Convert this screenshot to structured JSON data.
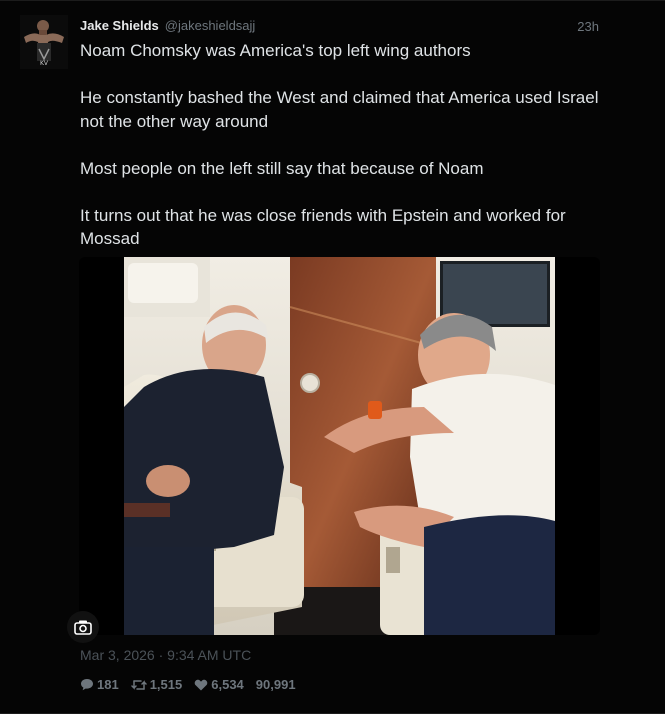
{
  "author": {
    "display_name": "Jake Shields",
    "handle": "@jakeshieldsajj"
  },
  "timestamp_relative": "23h",
  "tweet": {
    "paragraphs": [
      "Noam Chomsky was America's top left wing authors",
      "He constantly bashed the West and claimed that America used Israel not the other way around",
      "Most people on the left still say that because of Noam",
      "It turns out that he was close friends with Epstein and worked for Mossad"
    ]
  },
  "posted_at": "Mar 3, 2026 · 9:34 AM UTC",
  "stats": {
    "replies": "181",
    "retweets": "1,515",
    "likes": "6,534",
    "views": "90,991"
  },
  "icons": {
    "reply": "reply-bubble-icon",
    "retweet": "retweet-icon",
    "like": "heart-icon",
    "camera": "camera-icon"
  },
  "colors": {
    "background": "#000000",
    "text": "#dfe3e6",
    "muted": "#6e767d",
    "stats": "#6e767d"
  }
}
